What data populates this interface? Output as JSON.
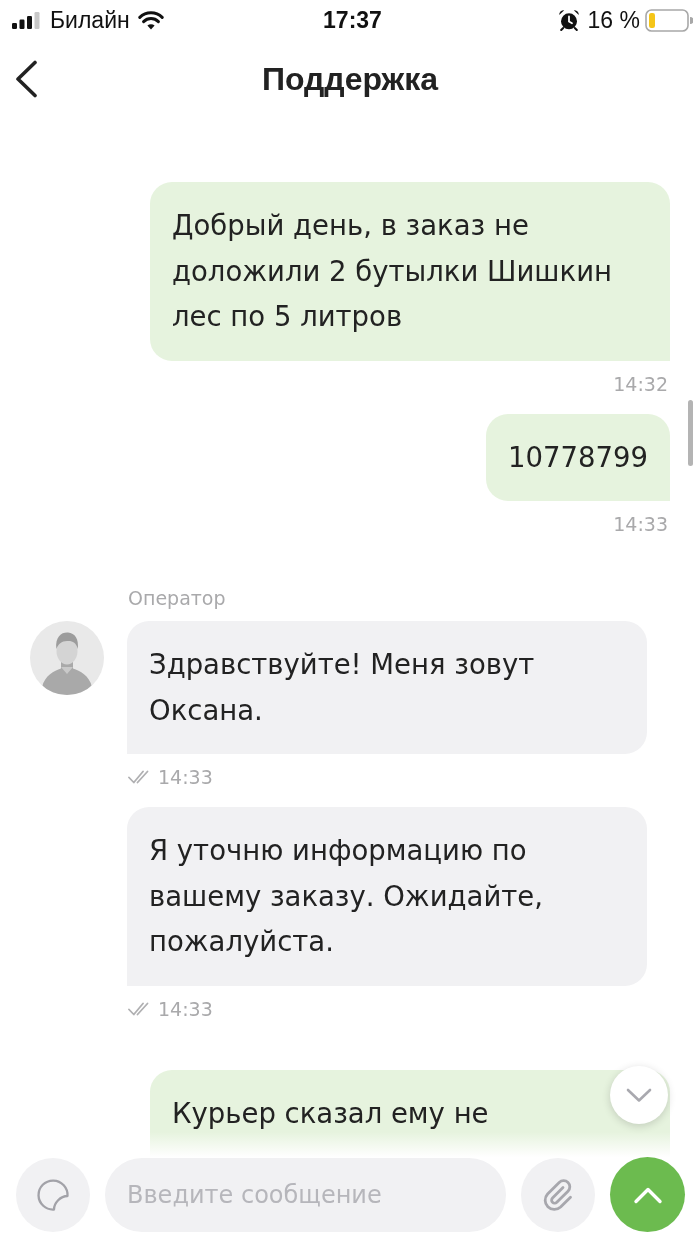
{
  "status_bar": {
    "carrier": "Билайн",
    "time": "17:37",
    "battery": "16 %"
  },
  "header": {
    "title": "Поддержка"
  },
  "messages": [
    {
      "kind": "outgoing",
      "text": "Добрый день, в заказ не доложили 2 бутылки Шишкин лес по 5 литров",
      "time": "14:32"
    },
    {
      "kind": "outgoing",
      "text": "10778799",
      "time": "14:33"
    },
    {
      "kind": "incoming",
      "sender": "Оператор",
      "text": "Здравствуйте! Меня зовут Оксана.",
      "time": "14:33",
      "read": true
    },
    {
      "kind": "incoming",
      "text": "Я уточню информацию по вашему заказу. Ожидайте, пожалуйста.",
      "time": "14:33",
      "read": true
    },
    {
      "kind": "outgoing",
      "text": "Курьер сказал ему не",
      "clipped": true
    }
  ],
  "composer": {
    "placeholder": "Введите сообщение"
  }
}
